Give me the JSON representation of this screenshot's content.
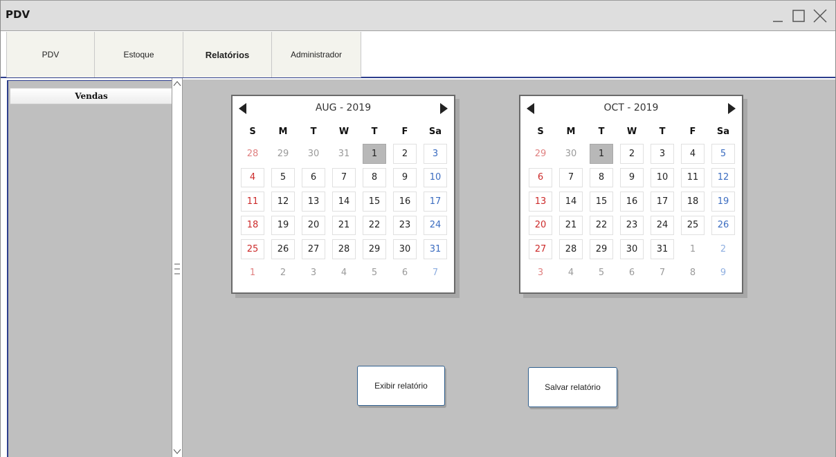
{
  "window": {
    "title": "PDV"
  },
  "tabs": [
    {
      "label": "PDV",
      "active": false
    },
    {
      "label": "Estoque",
      "active": false
    },
    {
      "label": "Relatórios",
      "active": true
    },
    {
      "label": "Administrador",
      "active": false
    }
  ],
  "sidebar": {
    "header": "Vendas"
  },
  "calendars": [
    {
      "title": "AUG - 2019",
      "weekdays": [
        "S",
        "M",
        "T",
        "W",
        "T",
        "F",
        "Sa"
      ],
      "selected": 1,
      "weeks": [
        [
          28,
          29,
          30,
          31,
          1,
          2,
          3
        ],
        [
          4,
          5,
          6,
          7,
          8,
          9,
          10
        ],
        [
          11,
          12,
          13,
          14,
          15,
          16,
          17
        ],
        [
          18,
          19,
          20,
          21,
          22,
          23,
          24
        ],
        [
          25,
          26,
          27,
          28,
          29,
          30,
          31
        ],
        [
          1,
          2,
          3,
          4,
          5,
          6,
          7
        ]
      ]
    },
    {
      "title": "OCT - 2019",
      "weekdays": [
        "S",
        "M",
        "T",
        "W",
        "T",
        "F",
        "Sa"
      ],
      "selected": 1,
      "weeks": [
        [
          29,
          30,
          1,
          2,
          3,
          4,
          5
        ],
        [
          6,
          7,
          8,
          9,
          10,
          11,
          12
        ],
        [
          13,
          14,
          15,
          16,
          17,
          18,
          19
        ],
        [
          20,
          21,
          22,
          23,
          24,
          25,
          26
        ],
        [
          27,
          28,
          29,
          30,
          31,
          1,
          2
        ],
        [
          3,
          4,
          5,
          6,
          7,
          8,
          9
        ]
      ]
    }
  ],
  "buttons": {
    "show_report": "Exibir relatório",
    "save_report": "Salvar relatório"
  },
  "colors": {
    "accent_border": "#2d3e8c",
    "sunday": "#cc2a2a",
    "saturday": "#3b6cc0",
    "selected_day": "#b8b8b8",
    "panel_gray": "#c0c0c0"
  },
  "icons": {
    "minimize": "minimize-icon",
    "maximize": "maximize-icon",
    "close": "close-icon",
    "prev": "triangle-left-icon",
    "next": "triangle-right-icon"
  }
}
